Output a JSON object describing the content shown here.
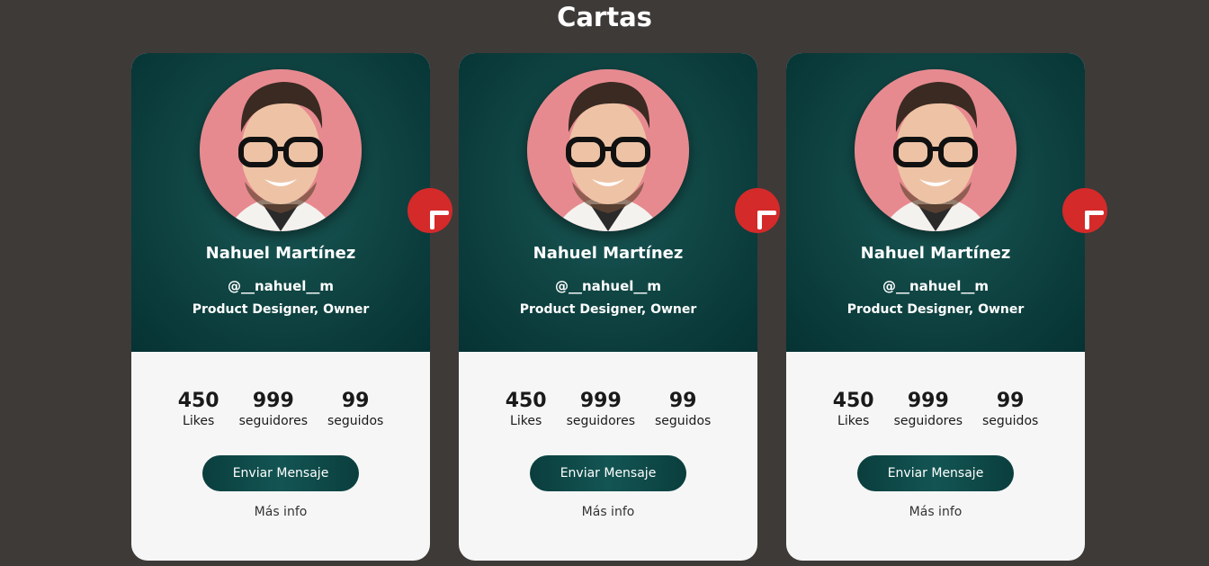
{
  "page": {
    "title": "Cartas"
  },
  "colors": {
    "background": "#3d3a38",
    "card_top_dark": "#063233",
    "card_top_light": "#1b5c5a",
    "add_button": "#d42a2a",
    "card_bottom": "#f6f6f6"
  },
  "cards": [
    {
      "name": "Nahuel Martínez",
      "handle": "@__nahuel__m",
      "role": "Product Designer, Owner",
      "add_icon": "plus-icon",
      "stats": [
        {
          "value": "450",
          "label": "Likes"
        },
        {
          "value": "999",
          "label": "seguidores"
        },
        {
          "value": "99",
          "label": "seguidos"
        }
      ],
      "button_label": "Enviar Mensaje",
      "link_label": "Más info"
    },
    {
      "name": "Nahuel Martínez",
      "handle": "@__nahuel__m",
      "role": "Product Designer, Owner",
      "add_icon": "plus-icon",
      "stats": [
        {
          "value": "450",
          "label": "Likes"
        },
        {
          "value": "999",
          "label": "seguidores"
        },
        {
          "value": "99",
          "label": "seguidos"
        }
      ],
      "button_label": "Enviar Mensaje",
      "link_label": "Más info"
    },
    {
      "name": "Nahuel Martínez",
      "handle": "@__nahuel__m",
      "role": "Product Designer, Owner",
      "add_icon": "plus-icon",
      "stats": [
        {
          "value": "450",
          "label": "Likes"
        },
        {
          "value": "999",
          "label": "seguidores"
        },
        {
          "value": "99",
          "label": "seguidos"
        }
      ],
      "button_label": "Enviar Mensaje",
      "link_label": "Más info"
    }
  ]
}
